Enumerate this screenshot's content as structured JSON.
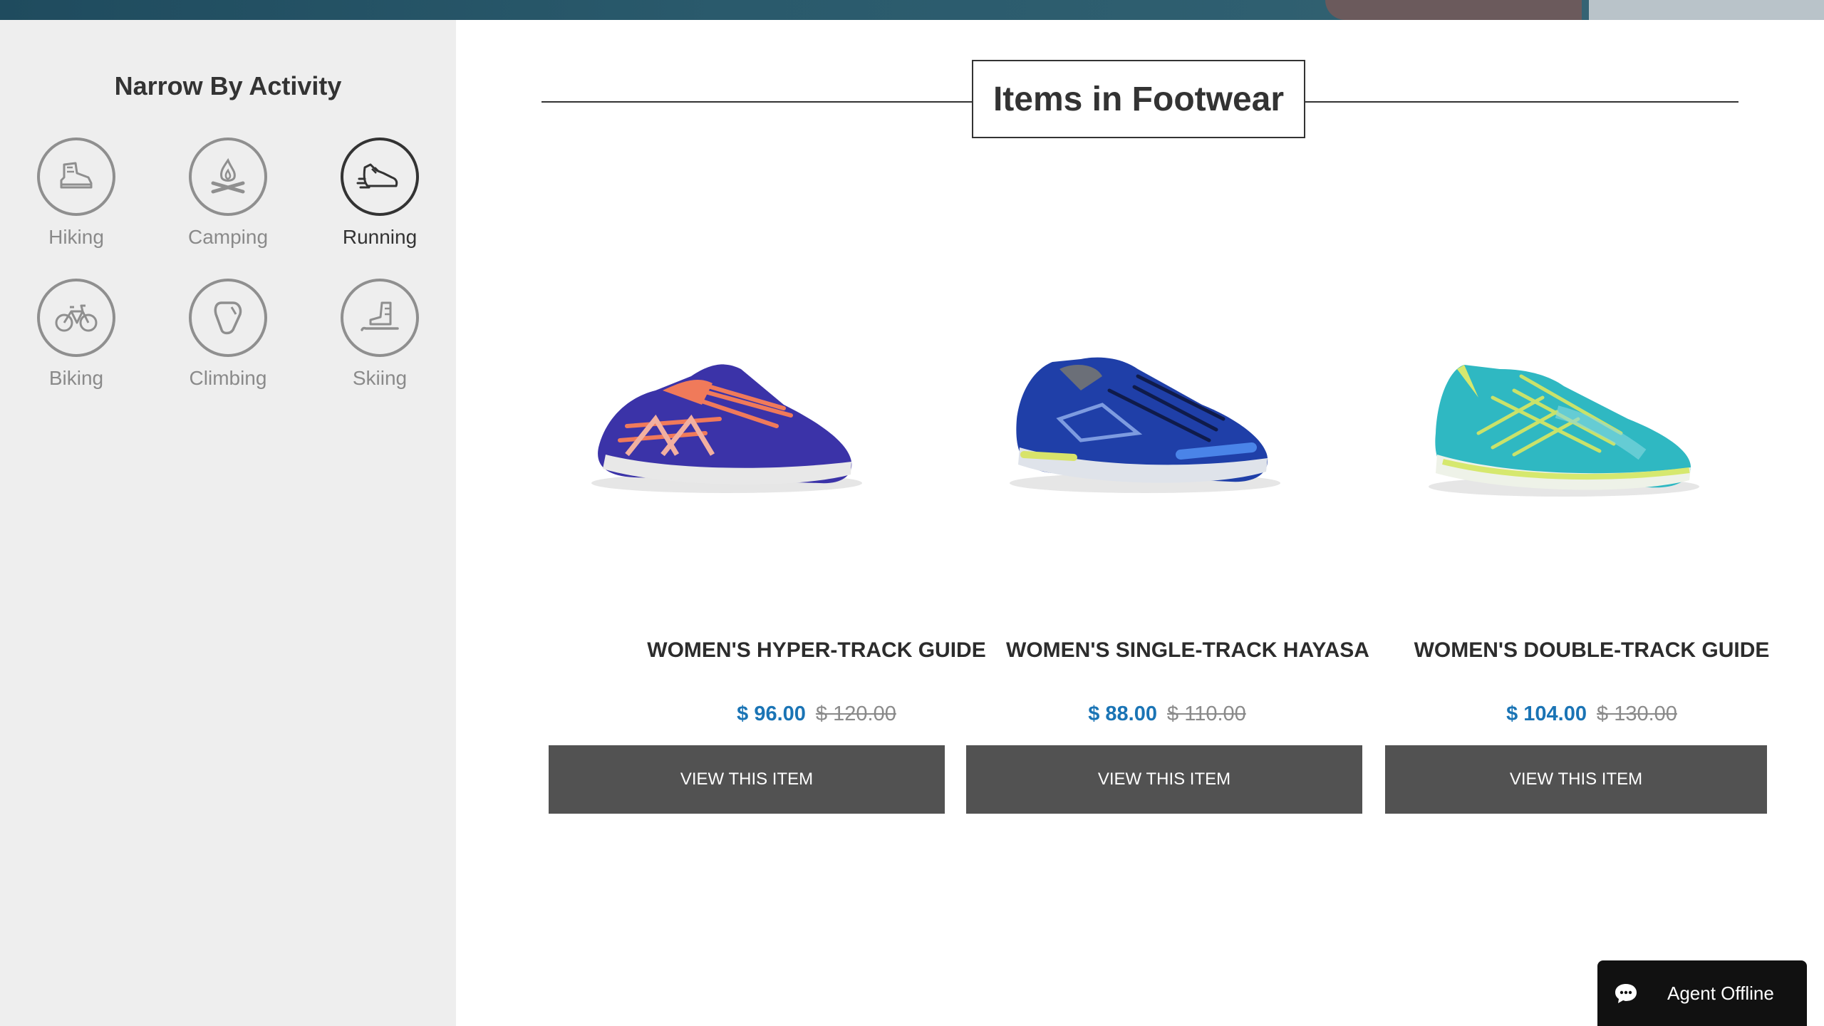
{
  "sidebar": {
    "title": "Narrow By Activity",
    "activities": [
      {
        "label": "Hiking",
        "icon": "hiking-boot-icon",
        "active": false
      },
      {
        "label": "Camping",
        "icon": "campfire-icon",
        "active": false
      },
      {
        "label": "Running",
        "icon": "running-shoe-icon",
        "active": true
      },
      {
        "label": "Biking",
        "icon": "bicycle-icon",
        "active": false
      },
      {
        "label": "Climbing",
        "icon": "carabiner-icon",
        "active": false
      },
      {
        "label": "Skiing",
        "icon": "ski-boot-icon",
        "active": false
      }
    ]
  },
  "main": {
    "heading": "Items in Footwear",
    "products": [
      {
        "name": "WOMEN'S HYPER-TRACK GUIDE",
        "sale_price": "$ 96.00",
        "original_price": "$ 120.00",
        "button": "VIEW THIS ITEM",
        "colors": {
          "upper": "#3b33a8",
          "accent": "#f07a5a",
          "sole": "#e8e8e8"
        }
      },
      {
        "name": "WOMEN'S SINGLE-TRACK HAYASA",
        "sale_price": "$ 88.00",
        "original_price": "$ 110.00",
        "button": "VIEW THIS ITEM",
        "colors": {
          "upper": "#1f3fa8",
          "accent": "#d8e36a",
          "sole": "#dfe3ea"
        }
      },
      {
        "name": "WOMEN'S DOUBLE-TRACK GUIDE",
        "sale_price": "$ 104.00",
        "original_price": "$ 130.00",
        "button": "VIEW THIS ITEM",
        "colors": {
          "upper": "#2fb8c2",
          "accent": "#d6e86e",
          "sole": "#eef2e8"
        }
      }
    ]
  },
  "chat": {
    "label": "Agent Offline",
    "icon": "chat-bubble-icon"
  },
  "colors": {
    "price_blue": "#1a74b5",
    "button_gray": "#525252",
    "sidebar_bg": "#eeeeee"
  }
}
